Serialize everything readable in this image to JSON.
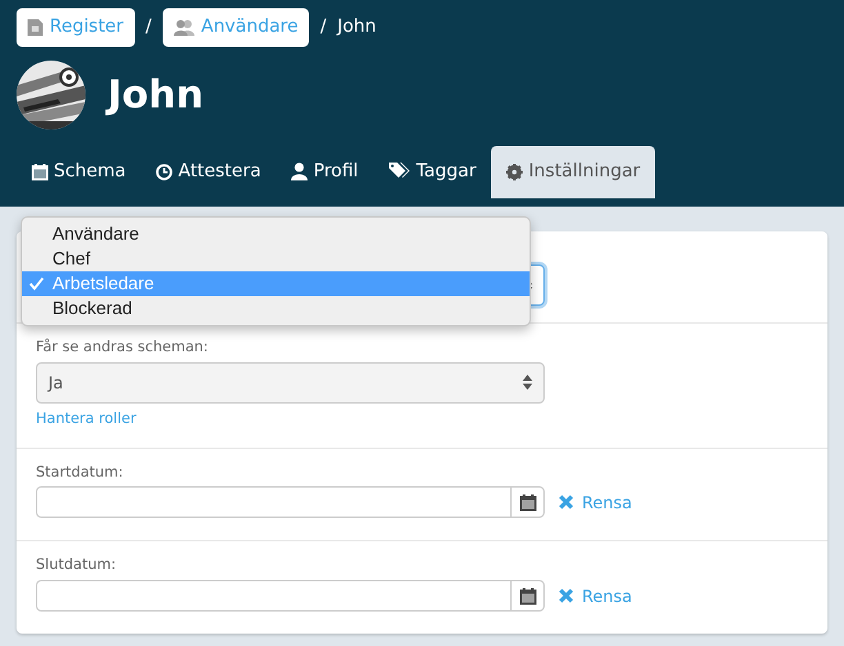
{
  "breadcrumb": {
    "separator": "/",
    "items": [
      {
        "label": "Register",
        "kind": "link"
      },
      {
        "label": "Användare",
        "kind": "link"
      },
      {
        "label": "John",
        "kind": "current"
      }
    ]
  },
  "user": {
    "name": "John"
  },
  "tabs": [
    {
      "label": "Schema",
      "selected": false
    },
    {
      "label": "Attestera",
      "selected": false
    },
    {
      "label": "Profil",
      "selected": false
    },
    {
      "label": "Taggar",
      "selected": false
    },
    {
      "label": "Inställningar",
      "selected": true
    }
  ],
  "sections": [
    {
      "kind": "select",
      "focused": true,
      "open": true,
      "options": [
        {
          "label": "Användare",
          "selected": false
        },
        {
          "label": "Chef",
          "selected": false
        },
        {
          "label": "Arbetsledare",
          "selected": true
        },
        {
          "label": "Blockerad",
          "selected": false
        }
      ]
    },
    {
      "kind": "select",
      "label": "Får se andras scheman:",
      "value": "Ja",
      "link": "Hantera roller"
    },
    {
      "kind": "date",
      "label": "Startdatum:",
      "clear": "Rensa"
    },
    {
      "kind": "date",
      "label": "Slutdatum:",
      "clear": "Rensa"
    }
  ]
}
